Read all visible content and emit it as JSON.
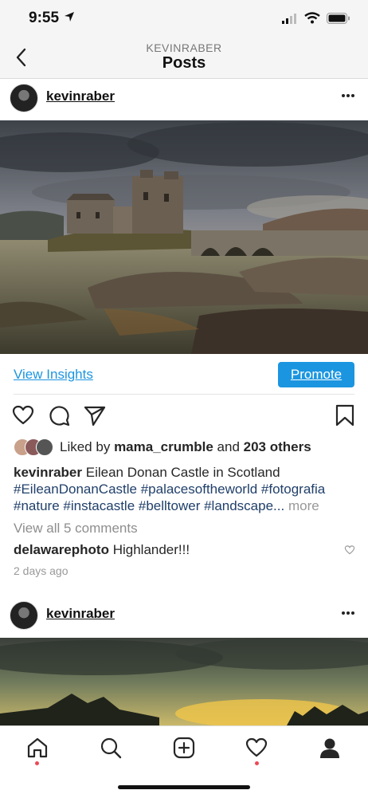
{
  "status": {
    "time": "9:55"
  },
  "nav": {
    "subtitle": "KEVINRABER",
    "title": "Posts"
  },
  "posts": [
    {
      "username": "kevinraber",
      "view_insights": "View Insights",
      "promote": "Promote",
      "likes": {
        "prefix": "Liked by",
        "user": "mama_crumble",
        "middle": "and",
        "others": "203 others"
      },
      "caption": {
        "author": "kevinraber",
        "text": "Eilean Donan Castle in Scotland",
        "hashtags_line1": "#EileanDonanCastle #palacesoftheworld #fotografia",
        "hashtags_line2": "#nature #instacastle #belltower #landscape...",
        "more": "more"
      },
      "view_comments": "View all 5 comments",
      "comment": {
        "author": "delawarephoto",
        "text": "Highlander!!!"
      },
      "time_ago": "2 days ago"
    },
    {
      "username": "kevinraber"
    }
  ],
  "icons": {
    "back": "chevron-left-icon",
    "more": "ellipsis-icon",
    "like": "heart-icon",
    "comment": "comment-icon",
    "share": "send-icon",
    "save": "bookmark-icon",
    "tabs": [
      "home-icon",
      "search-icon",
      "add-icon",
      "activity-heart-icon",
      "profile-icon"
    ]
  },
  "colors": {
    "link": "#1b95e0",
    "hashtag": "#21406b",
    "notification": "#ed4956"
  }
}
